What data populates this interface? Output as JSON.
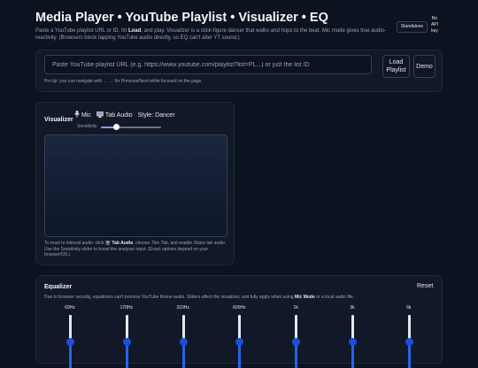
{
  "header": {
    "title": "Media Player • YouTube Playlist • Visualizer • EQ",
    "subtitle_parts": [
      "Paste a YouTube playlist URL or ID, hit ",
      "Load",
      ", and play. Visualizer is a stick-figure dancer that walks and hops to the beat. Mic mode gives true audio-reactivity. (Browsers block tapping YouTube audio directly, so EQ can't alter YT sound.)"
    ],
    "badge": "Standalone",
    "no_api_key": "No API key"
  },
  "playlist": {
    "placeholder": "Paste YouTube playlist URL (e.g. https://www.youtube.com/playlist?list=PL...) or just the list ID",
    "value": "",
    "load_label": "Load Playlist",
    "demo_label": "Demo",
    "tip": "Pro tip: you can navigate with ← → for Previous/Next while focused on the page."
  },
  "visualizer": {
    "title": "Visualizer",
    "mic_icon": "mic-icon",
    "mic_label": "Mic",
    "tab_icon": "monitor-icon",
    "tab_label": "Tab Audio",
    "style_label": "Style: Dancer",
    "sensitivity_label": "Sensitivity",
    "sensitivity_value": 0.25,
    "note_parts": [
      "To react to internal audio: click ",
      "Tab Audio",
      ", choose ",
      "This Tab",
      ", and enable ",
      "Share tab audio",
      ". Use the Sensitivity slider to boost the analyser input. (Exact options depend on your browser/OS.)"
    ]
  },
  "equalizer": {
    "title": "Equalizer",
    "reset_label": "Reset",
    "note_parts": [
      "Due to browser security, equalizers can't process YouTube iframe audio. Sliders affect the visualizer, and fully apply when using ",
      "Mic Mode",
      " or a local audio file."
    ],
    "bands": [
      {
        "label": "60Hz",
        "value": 0.5
      },
      {
        "label": "170Hz",
        "value": 0.5
      },
      {
        "label": "310Hz",
        "value": 0.5
      },
      {
        "label": "600Hz",
        "value": 0.5
      },
      {
        "label": "1k",
        "value": 0.5
      },
      {
        "label": "3k",
        "value": 0.5
      },
      {
        "label": "6k",
        "value": 0.5
      }
    ]
  },
  "colors": {
    "background": "#0b1220",
    "panel": "#111827",
    "accent": "#2563eb",
    "slider_accent": "#a78bfa"
  }
}
